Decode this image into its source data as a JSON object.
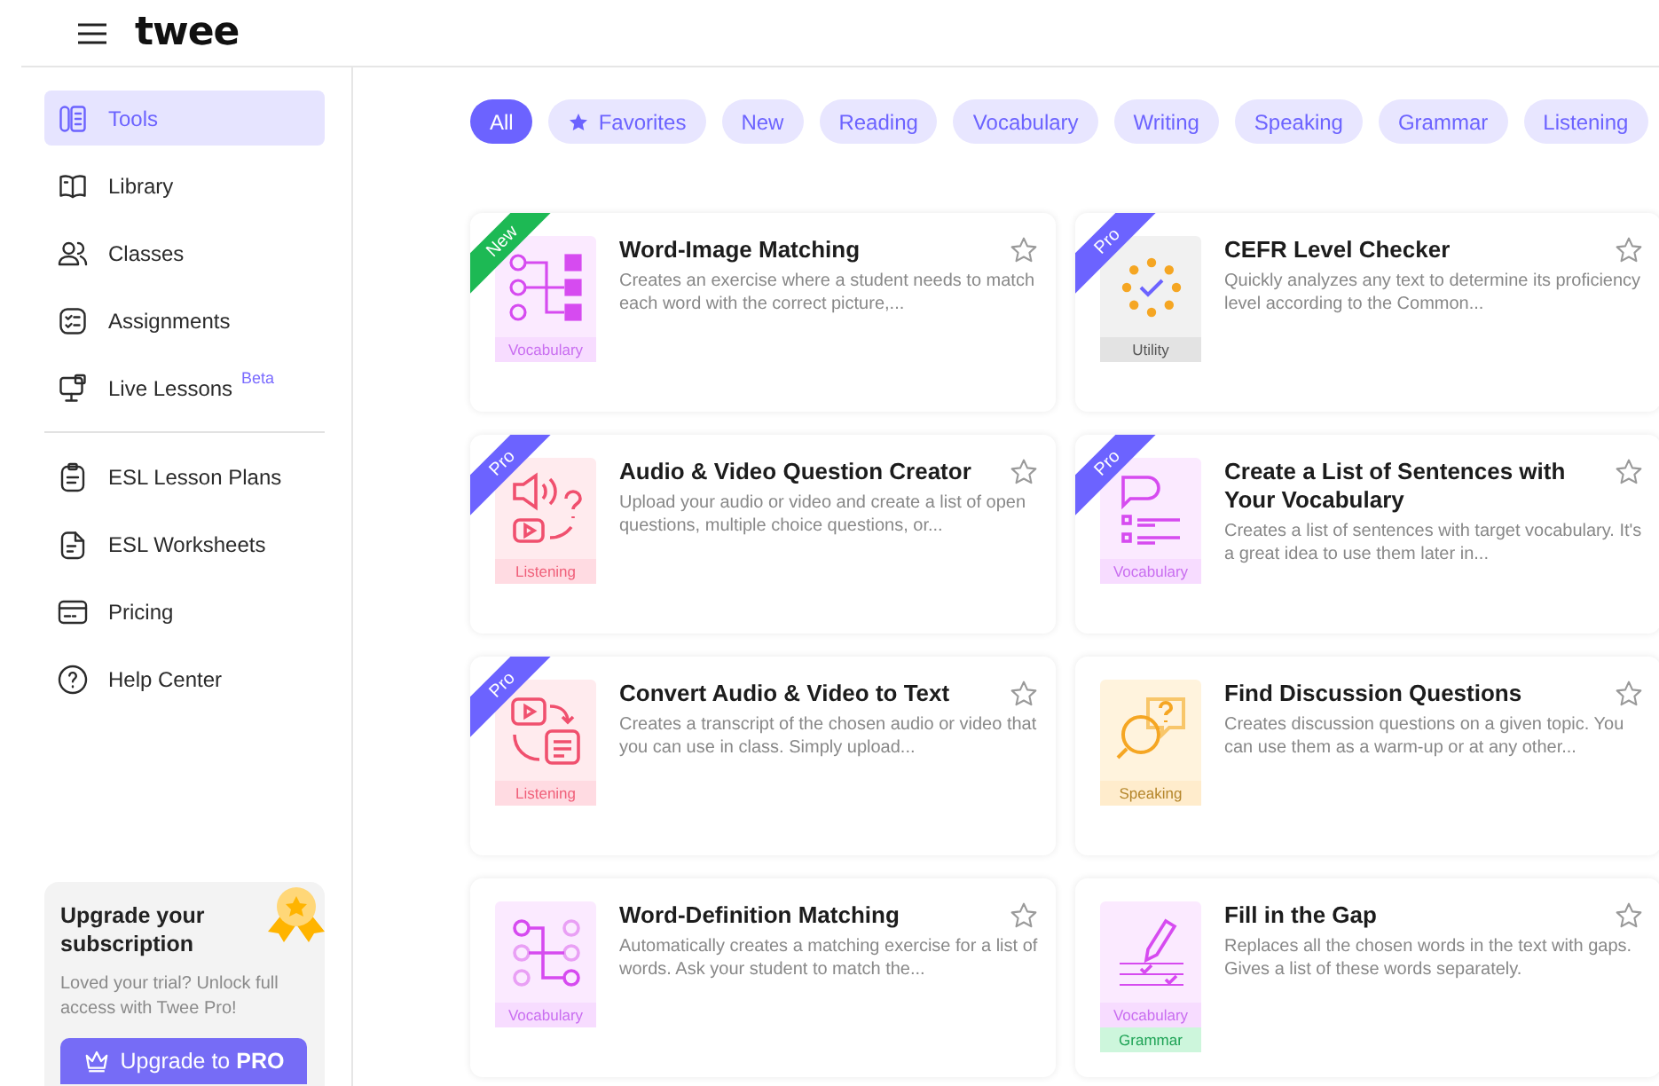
{
  "header": {
    "logo": "twee"
  },
  "sidebar": {
    "items": [
      {
        "label": "Tools",
        "kind": "tools",
        "selected": true
      },
      {
        "label": "Library",
        "kind": "library",
        "selected": false
      },
      {
        "label": "Classes",
        "kind": "classes",
        "selected": false
      },
      {
        "label": "Assignments",
        "kind": "assignments",
        "selected": false
      },
      {
        "label": "Live Lessons",
        "kind": "live",
        "badge": "Beta",
        "selected": false
      }
    ],
    "items_2": [
      {
        "label": "ESL Lesson Plans",
        "kind": "plans",
        "selected": false
      },
      {
        "label": "ESL Worksheets",
        "kind": "worksheets",
        "selected": false
      },
      {
        "label": "Pricing",
        "kind": "pricing",
        "selected": false
      },
      {
        "label": "Help Center",
        "kind": "help",
        "selected": false
      }
    ],
    "promo": {
      "title": "Upgrade your subscription",
      "text": "Loved your trial? Unlock full access with Twee Pro!",
      "button": "Upgrade to **PRO**"
    }
  },
  "filters": [
    {
      "label": "All",
      "selected": true
    },
    {
      "label": "Favorites",
      "kind": "favorites",
      "selected": false
    },
    {
      "label": "New",
      "selected": false
    },
    {
      "label": "Reading",
      "selected": false
    },
    {
      "label": "Vocabulary",
      "selected": false
    },
    {
      "label": "Writing",
      "selected": false
    },
    {
      "label": "Speaking",
      "selected": false
    },
    {
      "label": "Grammar",
      "selected": false
    },
    {
      "label": "Listening",
      "selected": false
    }
  ],
  "tools": [
    {
      "kind": "image-matching",
      "ribbon": {
        "kind": "new",
        "label": "New"
      },
      "title": "Word-Image Matching",
      "description": "Creates an exercise where a student needs to match each word with the correct picture,...",
      "tags": [
        {
          "kind": "vocabulary",
          "label": "Vocabulary"
        }
      ],
      "favorite": false
    },
    {
      "kind": "cefr",
      "ribbon": {
        "kind": "pro",
        "label": "Pro"
      },
      "title": "CEFR Level Checker",
      "description": "Quickly analyzes any text to determine its proficiency level according to the Common...",
      "tags": [
        {
          "kind": "utility",
          "label": "Utility"
        }
      ],
      "favorite": false
    },
    {
      "kind": "audio-questions",
      "ribbon": {
        "kind": "pro",
        "label": "Pro"
      },
      "title": "Audio & Video Question Creator",
      "description": "Upload your audio or video and create a list of open questions, multiple choice questions, or...",
      "tags": [
        {
          "kind": "listening",
          "label": "Listening"
        }
      ],
      "favorite": false
    },
    {
      "kind": "sentences",
      "ribbon": {
        "kind": "pro",
        "label": "Pro"
      },
      "title": "Create a List of Sentences with Your Vocabulary",
      "description": "Creates a list of sentences with target vocabulary. It's a great idea to use them later in...",
      "tags": [
        {
          "kind": "vocabulary",
          "label": "Vocabulary"
        }
      ],
      "favorite": false
    },
    {
      "kind": "transcript",
      "ribbon": {
        "kind": "pro",
        "label": "Pro"
      },
      "title": "Convert Audio & Video to Text",
      "description": "Creates a transcript of the chosen audio or video that you can use in class. Simply upload...",
      "tags": [
        {
          "kind": "listening",
          "label": "Listening"
        }
      ],
      "favorite": false
    },
    {
      "kind": "discussion",
      "title": "Find Discussion Questions",
      "description": "Creates discussion questions on a given topic. You can use them as a warm-up or at any other...",
      "tags": [
        {
          "kind": "speaking",
          "label": "Speaking"
        }
      ],
      "favorite": false
    },
    {
      "kind": "definition-matching",
      "title": "Word-Definition Matching",
      "description": "Automatically creates a matching exercise for a list of words. Ask your student to match the...",
      "tags": [
        {
          "kind": "vocabulary",
          "label": "Vocabulary"
        }
      ],
      "favorite": false
    },
    {
      "kind": "gap",
      "title": "Fill in the Gap",
      "description": "Replaces all the chosen words in the text with gaps. Gives a list of these words separately.",
      "tags": [
        {
          "kind": "vocabulary",
          "label": "Vocabulary"
        },
        {
          "kind": "grammar",
          "label": "Grammar"
        }
      ],
      "favorite": false
    }
  ]
}
